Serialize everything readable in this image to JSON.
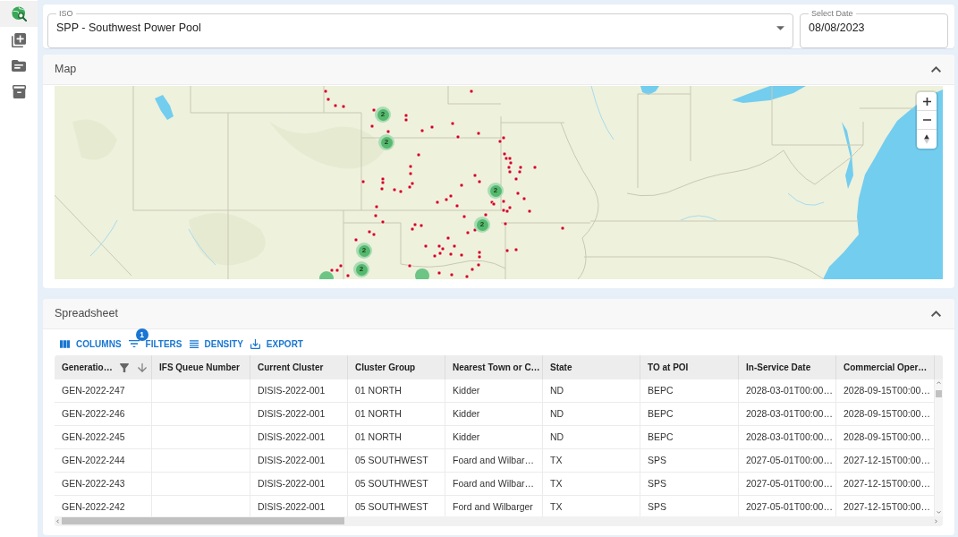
{
  "sidebar": {
    "items": [
      {
        "kind": "globe",
        "selected": true
      },
      {
        "kind": "document",
        "selected": false
      },
      {
        "kind": "folder",
        "selected": false
      },
      {
        "kind": "box",
        "selected": false
      }
    ]
  },
  "filters": {
    "iso": {
      "label": "ISO",
      "value": "SPP - Southwest Power Pool"
    },
    "date": {
      "label": "Select Date",
      "value": "08/08/2023"
    }
  },
  "map_panel": {
    "title": "Map",
    "expanded": true,
    "clusters": [
      {
        "count": "2"
      },
      {
        "count": "2"
      },
      {
        "count": "2"
      },
      {
        "count": "2"
      },
      {
        "count": "2"
      },
      {
        "count": "2"
      }
    ]
  },
  "spreadsheet": {
    "title": "Spreadsheet",
    "expanded": true,
    "toolbar": [
      {
        "kind": "columns",
        "label": "COLUMNS"
      },
      {
        "kind": "filters",
        "label": "FILTERS",
        "badge": "1"
      },
      {
        "kind": "density",
        "label": "DENSITY"
      },
      {
        "kind": "export",
        "label": "EXPORT"
      }
    ],
    "columns": [
      {
        "label": "Generatio…",
        "filtered": true,
        "sort_descending": true
      },
      {
        "label": "IFS Queue Number",
        "filtered": false,
        "sort_descending": false
      },
      {
        "label": "Current Cluster",
        "filtered": false,
        "sort_descending": false
      },
      {
        "label": "Cluster Group",
        "filtered": false,
        "sort_descending": false
      },
      {
        "label": "Nearest Town or C…",
        "filtered": false,
        "sort_descending": false
      },
      {
        "label": "State",
        "filtered": false,
        "sort_descending": false
      },
      {
        "label": "TO at POI",
        "filtered": false,
        "sort_descending": false
      },
      {
        "label": "In-Service Date",
        "filtered": false,
        "sort_descending": false
      },
      {
        "label": "Commercial Oper…",
        "filtered": false,
        "sort_descending": false
      }
    ],
    "rows": [
      {
        "column_1": "GEN-2022-247",
        "current_cluster": "DISIS-2022-001",
        "cluster_group": "01 NORTH",
        "column_5": "Kidder",
        "state": "ND",
        "to_at_poi": "BEPC",
        "in_service_date": "2028-03-01T00:00…",
        "column_9": "2028-09-15T00:00…"
      },
      {
        "column_1": "GEN-2022-246",
        "current_cluster": "DISIS-2022-001",
        "cluster_group": "01 NORTH",
        "column_5": "Kidder",
        "state": "ND",
        "to_at_poi": "BEPC",
        "in_service_date": "2028-03-01T00:00…",
        "column_9": "2028-09-15T00:00…"
      },
      {
        "column_1": "GEN-2022-245",
        "current_cluster": "DISIS-2022-001",
        "cluster_group": "01 NORTH",
        "column_5": "Kidder",
        "state": "ND",
        "to_at_poi": "BEPC",
        "in_service_date": "2028-03-01T00:00…",
        "column_9": "2028-09-15T00:00…"
      },
      {
        "column_1": "GEN-2022-244",
        "current_cluster": "DISIS-2022-001",
        "cluster_group": "05 SOUTHWEST",
        "column_5": "Foard and Wilbar…",
        "state": "TX",
        "to_at_poi": "SPS",
        "in_service_date": "2027-05-01T00:00…",
        "column_9": "2027-12-15T00:00…"
      },
      {
        "column_1": "GEN-2022-243",
        "current_cluster": "DISIS-2022-001",
        "cluster_group": "05 SOUTHWEST",
        "column_5": "Foard and Wilbar…",
        "state": "TX",
        "to_at_poi": "SPS",
        "in_service_date": "2027-05-01T00:00…",
        "column_9": "2027-12-15T00:00…"
      },
      {
        "column_1": "GEN-2022-242",
        "current_cluster": "DISIS-2022-001",
        "cluster_group": "05 SOUTHWEST",
        "column_5": "Ford and Wilbarger",
        "state": "TX",
        "to_at_poi": "SPS",
        "in_service_date": "2027-05-01T00:00…",
        "column_9": "2027-12-15T00:00…"
      }
    ]
  }
}
